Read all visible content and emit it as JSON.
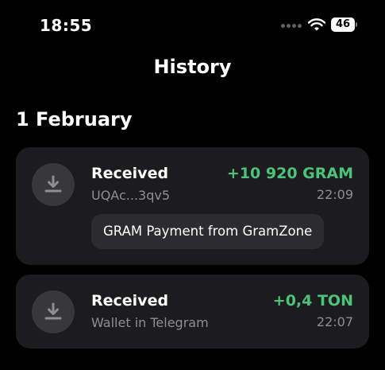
{
  "status_bar": {
    "time": "18:55",
    "battery_level": "46",
    "signal": "no-service-dots",
    "wifi": "wifi-icon"
  },
  "header": {
    "title": "History"
  },
  "sections": [
    {
      "date": "1 February",
      "transactions": [
        {
          "type": "Received",
          "subtitle": "UQAc...3qv5",
          "amount": "+10 920 GRAM",
          "time": "22:09",
          "comment": "GRAM Payment from GramZone",
          "icon": "download-arrow-icon"
        },
        {
          "type": "Received",
          "subtitle": "Wallet in Telegram",
          "amount": "+0,4 TON",
          "time": "22:07",
          "icon": "download-arrow-icon"
        }
      ]
    }
  ],
  "colors": {
    "background": "#000000",
    "card": "#1c1c1e",
    "comment_bubble": "#2c2c2e",
    "icon_circle": "#38383a",
    "positive_amount": "#4cc27a",
    "secondary_text": "#8e8e93"
  }
}
